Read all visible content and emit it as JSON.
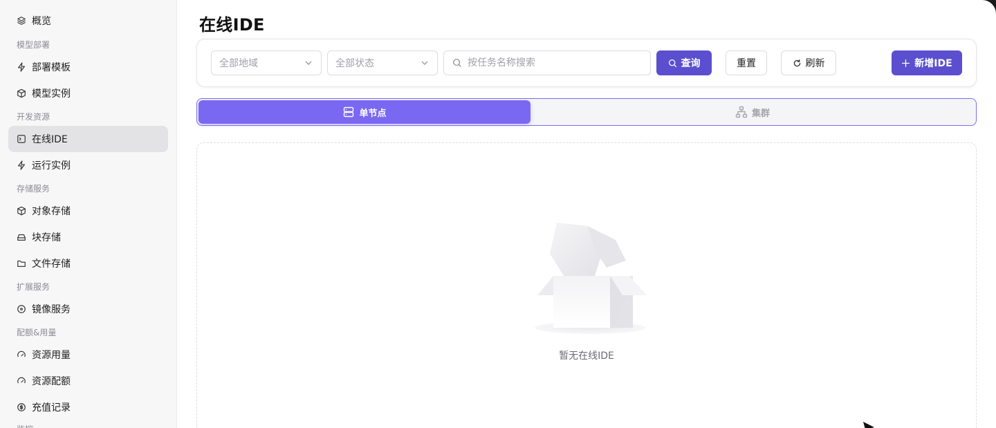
{
  "sidebar": {
    "items": [
      {
        "label": "概览",
        "icon": "layers-icon"
      },
      {
        "section": "模型部署"
      },
      {
        "label": "部署模板",
        "icon": "bolt-icon"
      },
      {
        "label": "模型实例",
        "icon": "cube-icon"
      },
      {
        "section": "开发资源"
      },
      {
        "label": "在线IDE",
        "icon": "terminal-icon",
        "active": true
      },
      {
        "label": "运行实例",
        "icon": "bolt-icon"
      },
      {
        "section": "存储服务"
      },
      {
        "label": "对象存储",
        "icon": "box-icon"
      },
      {
        "label": "块存储",
        "icon": "drive-icon"
      },
      {
        "label": "文件存储",
        "icon": "folder-icon"
      },
      {
        "section": "扩展服务"
      },
      {
        "label": "镜像服务",
        "icon": "disc-icon"
      },
      {
        "section": "配额&用量"
      },
      {
        "label": "资源用量",
        "icon": "gauge-icon"
      },
      {
        "label": "资源配额",
        "icon": "gauge-icon"
      },
      {
        "label": "充值记录",
        "icon": "coin-icon"
      },
      {
        "section": "监控"
      }
    ]
  },
  "page": {
    "title": "在线IDE"
  },
  "toolbar": {
    "region_select": "全部地域",
    "status_select": "全部状态",
    "search_placeholder": "按任务名称搜索",
    "query_label": "查询",
    "reset_label": "重置",
    "refresh_label": "刷新",
    "add_label": "新增IDE"
  },
  "tabs": {
    "single": "单节点",
    "cluster": "集群"
  },
  "empty": {
    "text": "暂无在线IDE"
  },
  "colors": {
    "primary": "#5b4fcf",
    "segment_active": "#7a68f2",
    "sidebar_bg": "#f7f7f8",
    "active_item_bg": "#e3e3e6"
  }
}
